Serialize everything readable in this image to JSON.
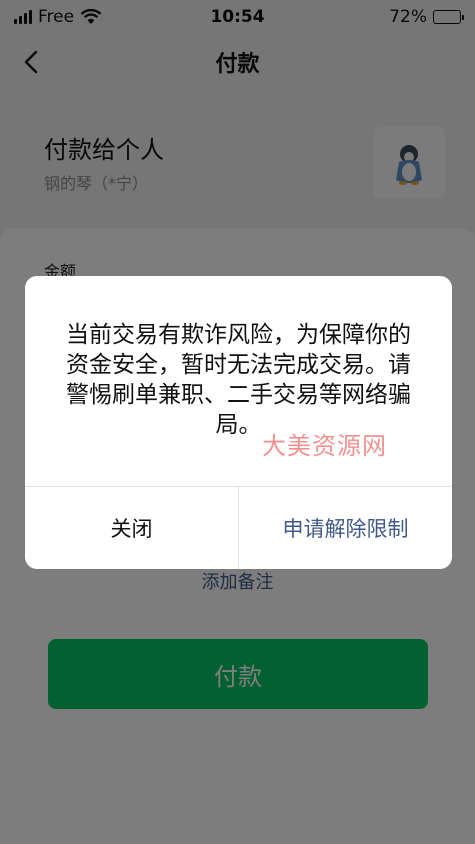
{
  "status_bar": {
    "carrier": "Free",
    "time": "10:54",
    "battery": "72%",
    "battery_level": 0.72
  },
  "nav": {
    "title": "付款"
  },
  "payee": {
    "title": "付款给个人",
    "name": "钢的琴（*宁）"
  },
  "card": {
    "amount_label": "金额",
    "remark_link": "添加备注",
    "pay_button": "付款"
  },
  "dialog": {
    "message": "当前交易有欺诈风险，为保障你的资金安全，暂时无法完成交易。请警惕刷单兼职、二手交易等网络骗局。",
    "close_button": "关闭",
    "appeal_button": "申请解除限制"
  },
  "watermark": "大美资源网",
  "colors": {
    "accent_green": "#07c160",
    "link_blue": "#3f5a8a"
  }
}
